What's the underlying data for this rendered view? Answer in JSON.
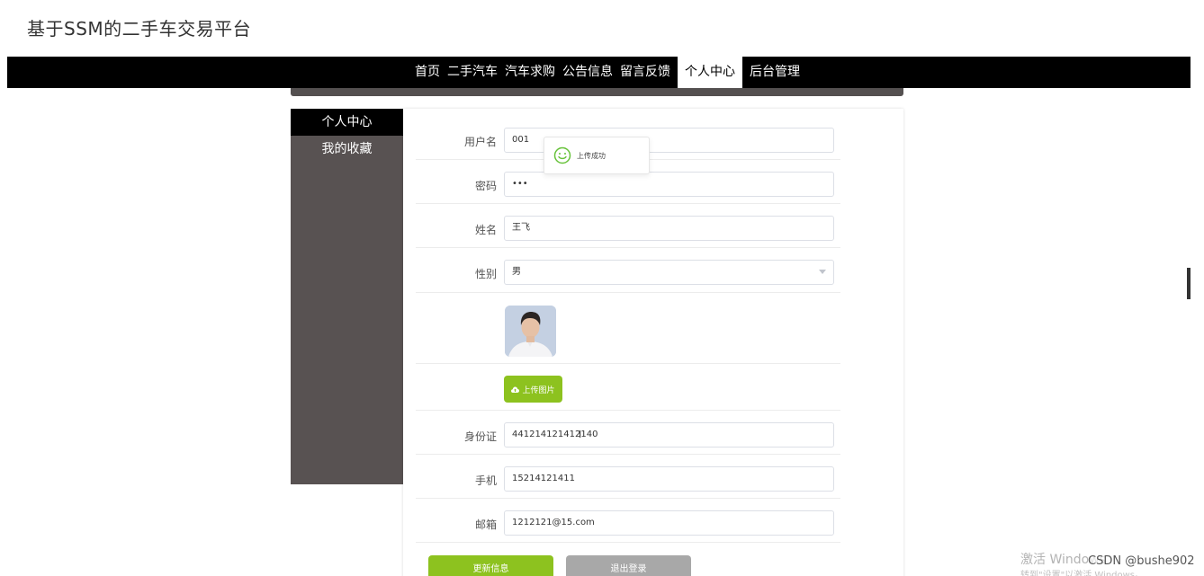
{
  "site": {
    "title": "基于SSM的二手车交易平台"
  },
  "nav": {
    "items": [
      {
        "label": "首页"
      },
      {
        "label": "二手汽车"
      },
      {
        "label": "汽车求购"
      },
      {
        "label": "公告信息"
      },
      {
        "label": "留言反馈"
      },
      {
        "label": "个人中心",
        "active": true
      },
      {
        "label": "后台管理"
      }
    ]
  },
  "sidebar": {
    "items": [
      {
        "label": "个人中心",
        "active": true
      },
      {
        "label": "我的收藏"
      }
    ]
  },
  "form": {
    "username": {
      "label": "用户名",
      "value": "001"
    },
    "password": {
      "label": "密码",
      "value": "•••"
    },
    "name": {
      "label": "姓名",
      "value": "王飞"
    },
    "gender": {
      "label": "性别",
      "value": "男"
    },
    "upload_label": "上传图片",
    "id_card": {
      "label": "身份证",
      "value": "441214121412140"
    },
    "phone": {
      "label": "手机",
      "value": "15214121411"
    },
    "email": {
      "label": "邮箱",
      "value": "1212121@15.com"
    },
    "update_button": "更新信息",
    "logout_button": "退出登录"
  },
  "toast": {
    "text": "上传成功",
    "icon": "smile-icon",
    "color": "#67c23a"
  },
  "watermarks": {
    "windows_line1": "激活 Windows",
    "windows_line2": "转到\"设置\"以激活 Windows。",
    "csdn": "CSDN @bushe902"
  },
  "colors": {
    "accent": "#8dc21f",
    "nav_bg": "#000000",
    "sidebar_bg": "#585252",
    "logout_bg": "#a8a8a8"
  }
}
